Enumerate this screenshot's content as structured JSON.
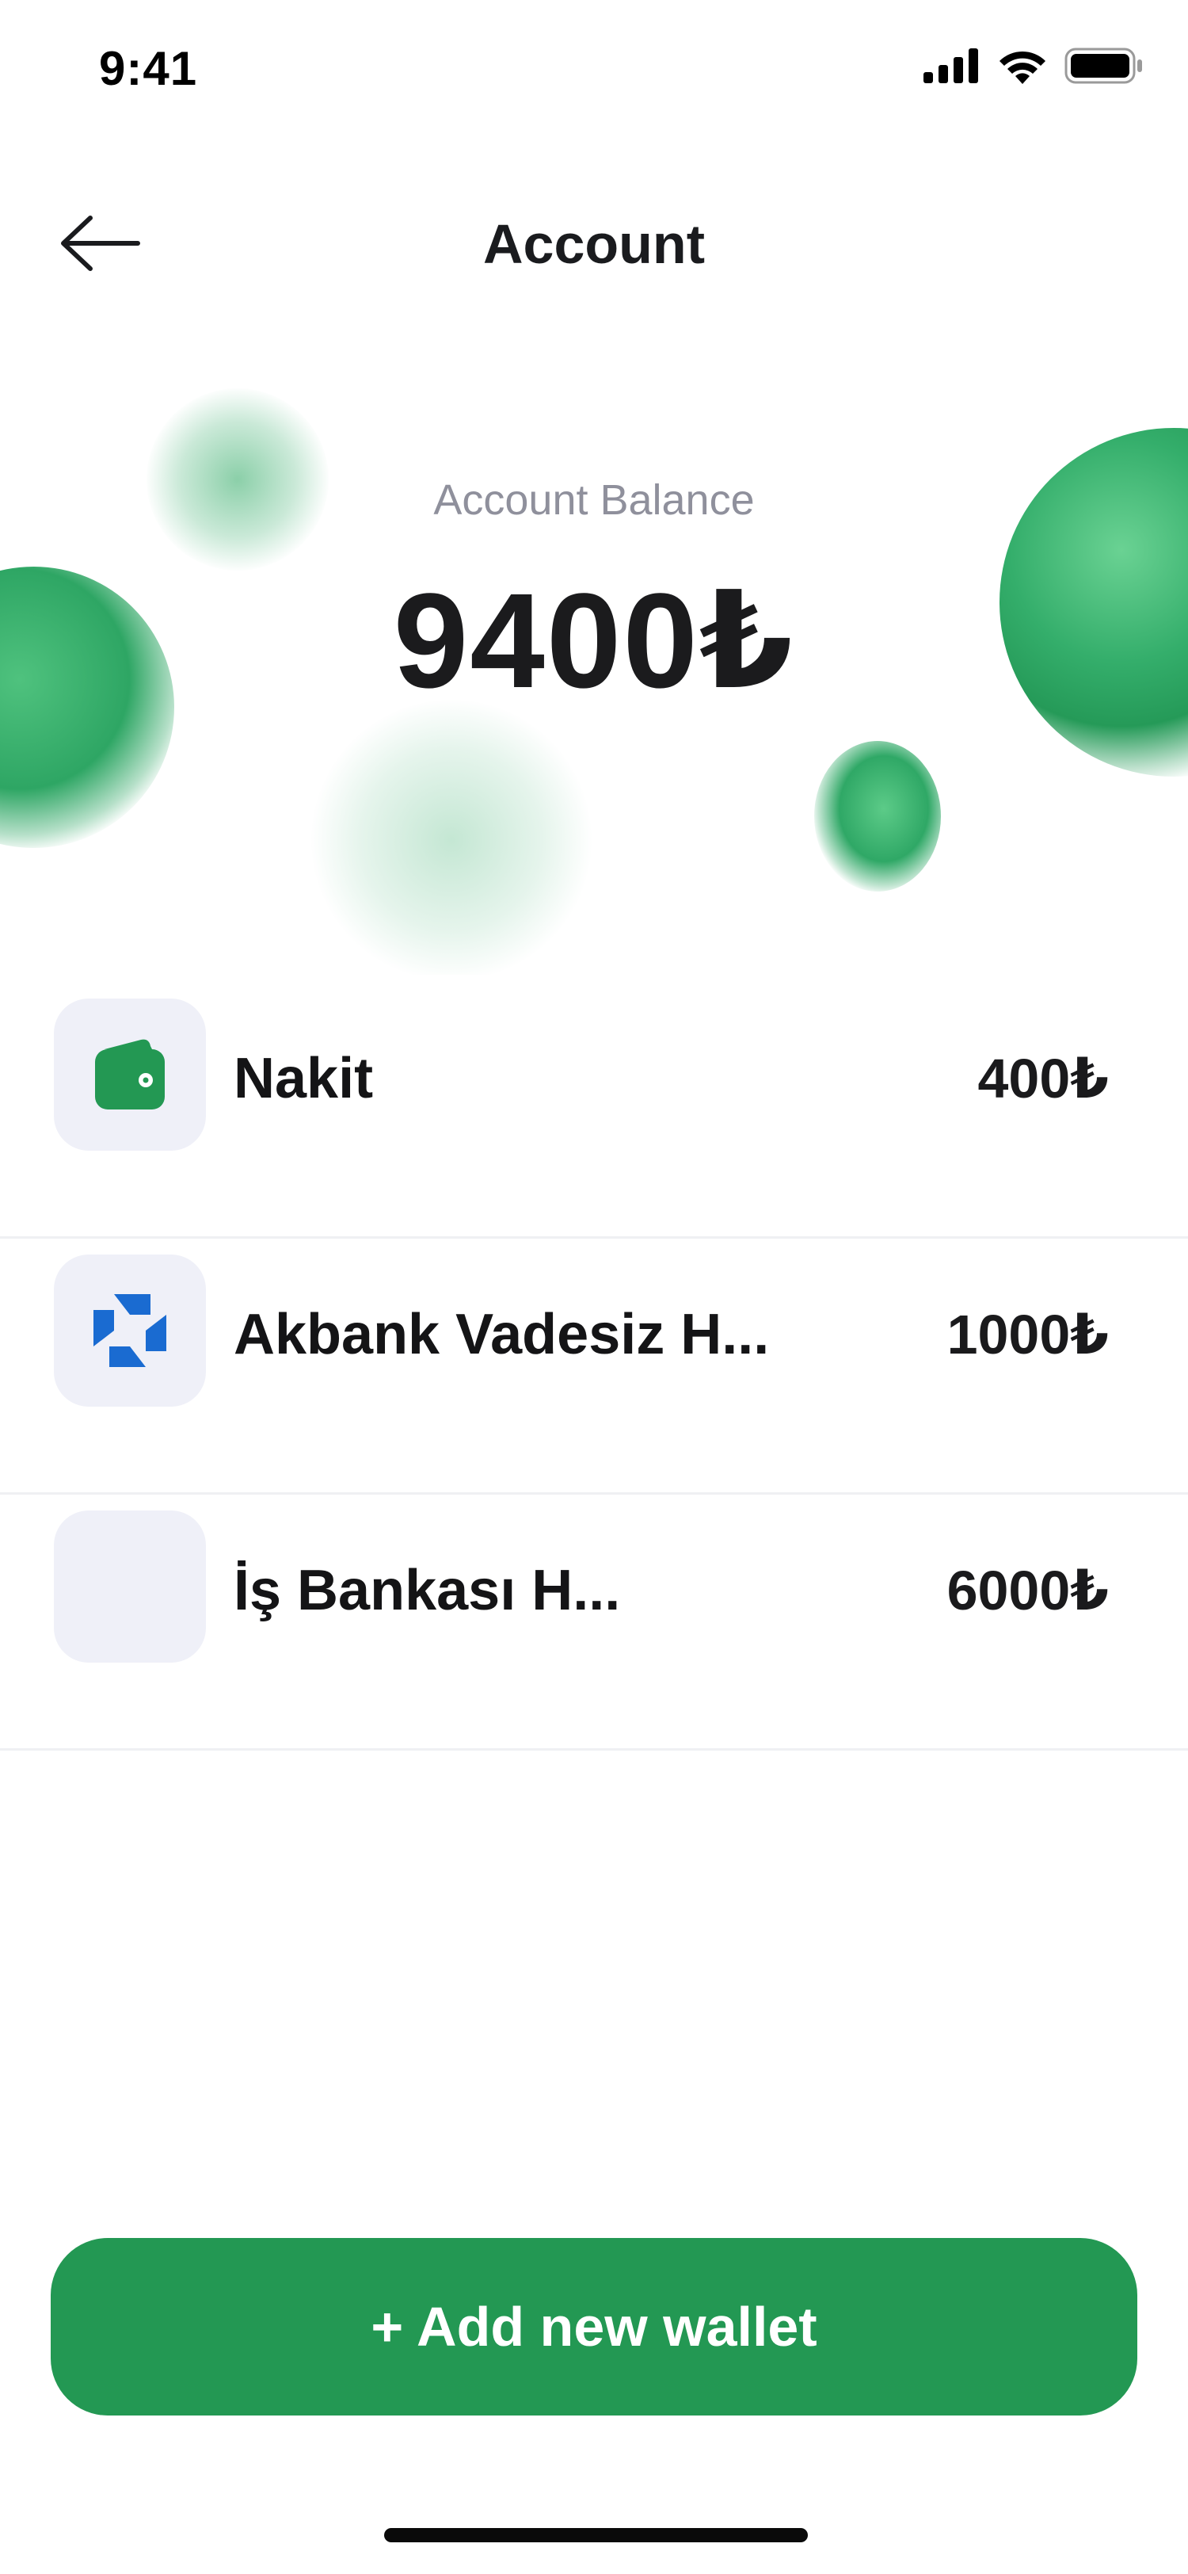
{
  "status_bar": {
    "time": "9:41"
  },
  "header": {
    "title": "Account",
    "back_icon": "arrow-left-icon"
  },
  "balance": {
    "label": "Account Balance",
    "amount": "9400₺"
  },
  "wallets": [
    {
      "name": "Nakit",
      "amount": "400₺",
      "icon": "wallet-icon"
    },
    {
      "name": "Akbank Vadesiz H...",
      "amount": "1000₺",
      "icon": "bank-logo-icon"
    },
    {
      "name": "İş Bankası H...",
      "amount": "6000₺",
      "icon": ""
    }
  ],
  "actions": {
    "add_wallet_label": "+ Add new wallet"
  },
  "colors": {
    "accent": "#239853",
    "icon_bg": "#eff0f8",
    "muted_text": "#8f909c",
    "divider": "#eff0f3"
  }
}
